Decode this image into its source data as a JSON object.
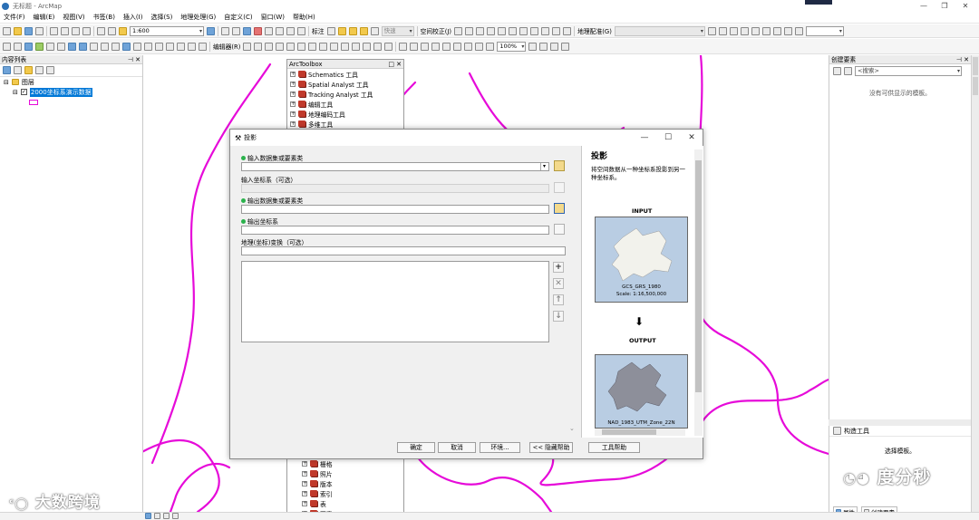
{
  "window": {
    "title": "无标题 - ArcMap"
  },
  "menu": [
    "文件(F)",
    "编辑(E)",
    "视图(V)",
    "书签(B)",
    "插入(I)",
    "选择(S)",
    "地理处理(G)",
    "自定义(C)",
    "窗口(W)",
    "帮助(H)"
  ],
  "toolbar": {
    "scale": "1:600",
    "annotation_label": "标注",
    "fast_label": "快速",
    "spatial_adjust_label": "空间校正(J)",
    "georef_label": "地理配准(G)",
    "editor_label": "编辑器(R)",
    "zoom_percent": "100%"
  },
  "toc": {
    "title": "内容列表",
    "root_layer": "图层",
    "layer": "2000坐标系演示数据"
  },
  "toolbox": {
    "title": "ArcToolbox",
    "items": [
      "Schematics 工具",
      "Spatial Analyst 工具",
      "Tracking Analyst 工具",
      "编辑工具",
      "地理编码工具",
      "多维工具"
    ],
    "lower_items": [
      "栅格",
      "照片",
      "版本",
      "索引",
      "表",
      "要素"
    ]
  },
  "dialog": {
    "title": "投影",
    "input_label": "输入数据集或要素类",
    "input_cs_label": "输入坐标系（可选）",
    "output_label": "输出数据集或要素类",
    "output_cs_label": "输出坐标系",
    "transform_label": "地理(坐标)变换（可选）",
    "buttons": {
      "ok": "确定",
      "cancel": "取消",
      "env": "环境...",
      "hide_help": "<< 隐藏帮助",
      "tool_help": "工具帮助"
    },
    "help": {
      "title": "投影",
      "description": "将空间数据从一种坐标系投影到另一种坐标系。",
      "input_caption": "INPUT",
      "input_cs": "GCS_GRS_1980",
      "input_scale": "Scale: 1:16,500,000",
      "output_caption": "OUTPUT",
      "output_cs": "NAD_1983_UTM_Zone_22N"
    }
  },
  "catalog": {
    "title": "创建要素",
    "search_placeholder": "<搜索>",
    "empty_message": "没有可供显示的模板。"
  },
  "construct": {
    "title": "构造工具",
    "message": "选择模板。",
    "tab_attributes": "属性",
    "tab_create": "创建要素"
  },
  "watermarks": {
    "left": "大数跨境",
    "right": "度分秒"
  },
  "colors": {
    "boundary": "#e60ad9",
    "selection": "#0078d7",
    "help_map_bg": "#b9cde3"
  }
}
